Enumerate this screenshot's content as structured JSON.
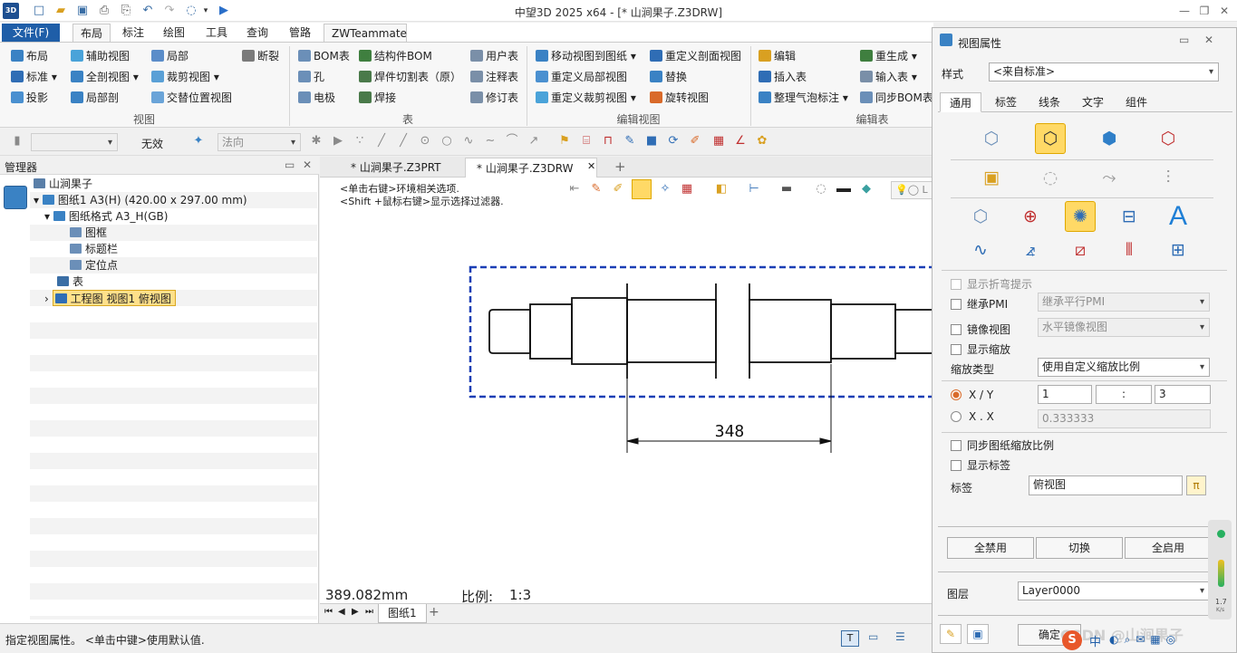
{
  "app": {
    "title": "中望3D 2025 x64 - [* 山涧果子.Z3DRW]",
    "logo_text": "3D"
  },
  "ribbon": {
    "tabs": [
      "文件(F)",
      "布局",
      "标注",
      "绘图",
      "工具",
      "查询",
      "管路",
      "ZWTeammate"
    ],
    "active_tab": "布局",
    "groups": {
      "view": {
        "label": "视图",
        "items": [
          "布局",
          "辅助视图",
          "局部",
          "断裂",
          "标准",
          "全剖视图",
          "裁剪视图",
          "投影",
          "局部剖",
          "交替位置视图"
        ]
      },
      "table": {
        "label": "表",
        "items": [
          "BOM表",
          "结构件BOM",
          "用户表",
          "孔",
          "焊件切割表（原）",
          "注释表",
          "电极",
          "焊接",
          "修订表"
        ]
      },
      "edit_view": {
        "label": "编辑视图",
        "items": [
          "移动视图到图纸",
          "重定义剖面视图",
          "重定义局部视图",
          "替换",
          "重定义裁剪视图",
          "旋转视图"
        ]
      },
      "edit_table": {
        "label": "编辑表",
        "items": [
          "编辑",
          "重生成",
          "插入表",
          "输入表",
          "整理气泡标注",
          "同步BOM表"
        ]
      }
    }
  },
  "toolbar2": {
    "invalid_label": "无效",
    "direction": "法向"
  },
  "manager": {
    "title": "管理器",
    "tree": [
      {
        "label": "山涧果子",
        "level": 0
      },
      {
        "label": "图纸1 A3(H) (420.00 x 297.00 mm)",
        "level": 1
      },
      {
        "label": "图纸格式 A3_H(GB)",
        "level": 2
      },
      {
        "label": "图框",
        "level": 3
      },
      {
        "label": "标题栏",
        "level": 3
      },
      {
        "label": "定位点",
        "level": 3
      },
      {
        "label": "表",
        "level": 2
      },
      {
        "label": "工程图 视图1 俯视图",
        "level": 2
      }
    ]
  },
  "doc_tabs": [
    "* 山涧果子.Z3PRT",
    "* 山涧果子.Z3DRW"
  ],
  "canvas": {
    "hint1": "<单击右键>环境相关选项.",
    "hint2": "<Shift +鼠标右键>显示选择过滤器.",
    "dimension": "348",
    "measure": "389.082mm",
    "scale_label": "比例:",
    "scale_value": "1:3"
  },
  "sheet_tab": "图纸1",
  "status": {
    "prompt": "指定视图属性。  <单击中键>使用默认值."
  },
  "panel": {
    "title": "视图属性",
    "style_label": "样式",
    "style_value": "<来自标准>",
    "tabs": [
      "通用",
      "标签",
      "线条",
      "文字",
      "组件"
    ],
    "active_tab": "通用",
    "checkboxes": {
      "show_bend": "显示折弯提示",
      "inherit_pmi": "继承PMI",
      "inherit_pmi_value": "继承平行PMI",
      "mirror": "镜像视图",
      "mirror_value": "水平镜像视图",
      "show_scale": "显示缩放",
      "sync_scale": "同步图纸缩放比例",
      "show_label": "显示标签"
    },
    "scale_type_label": "缩放类型",
    "scale_type_value": "使用自定义缩放比例",
    "xy_label": "X / Y",
    "xx_label": "X . X",
    "x_value": "1",
    "colon": ":",
    "y_value": "3",
    "decimal_value": "0.333333",
    "label_label": "标签",
    "label_value": "俯视图",
    "buttons": {
      "disable_all": "全禁用",
      "toggle": "切换",
      "enable_all": "全启用",
      "ok": "确定"
    },
    "layer_label": "图层",
    "layer_value": "Layer0000"
  },
  "tray": {
    "speed": "1.7",
    "speed_unit": "K/s",
    "watermark": "CSDN @山涧果子",
    "ime": "中"
  }
}
